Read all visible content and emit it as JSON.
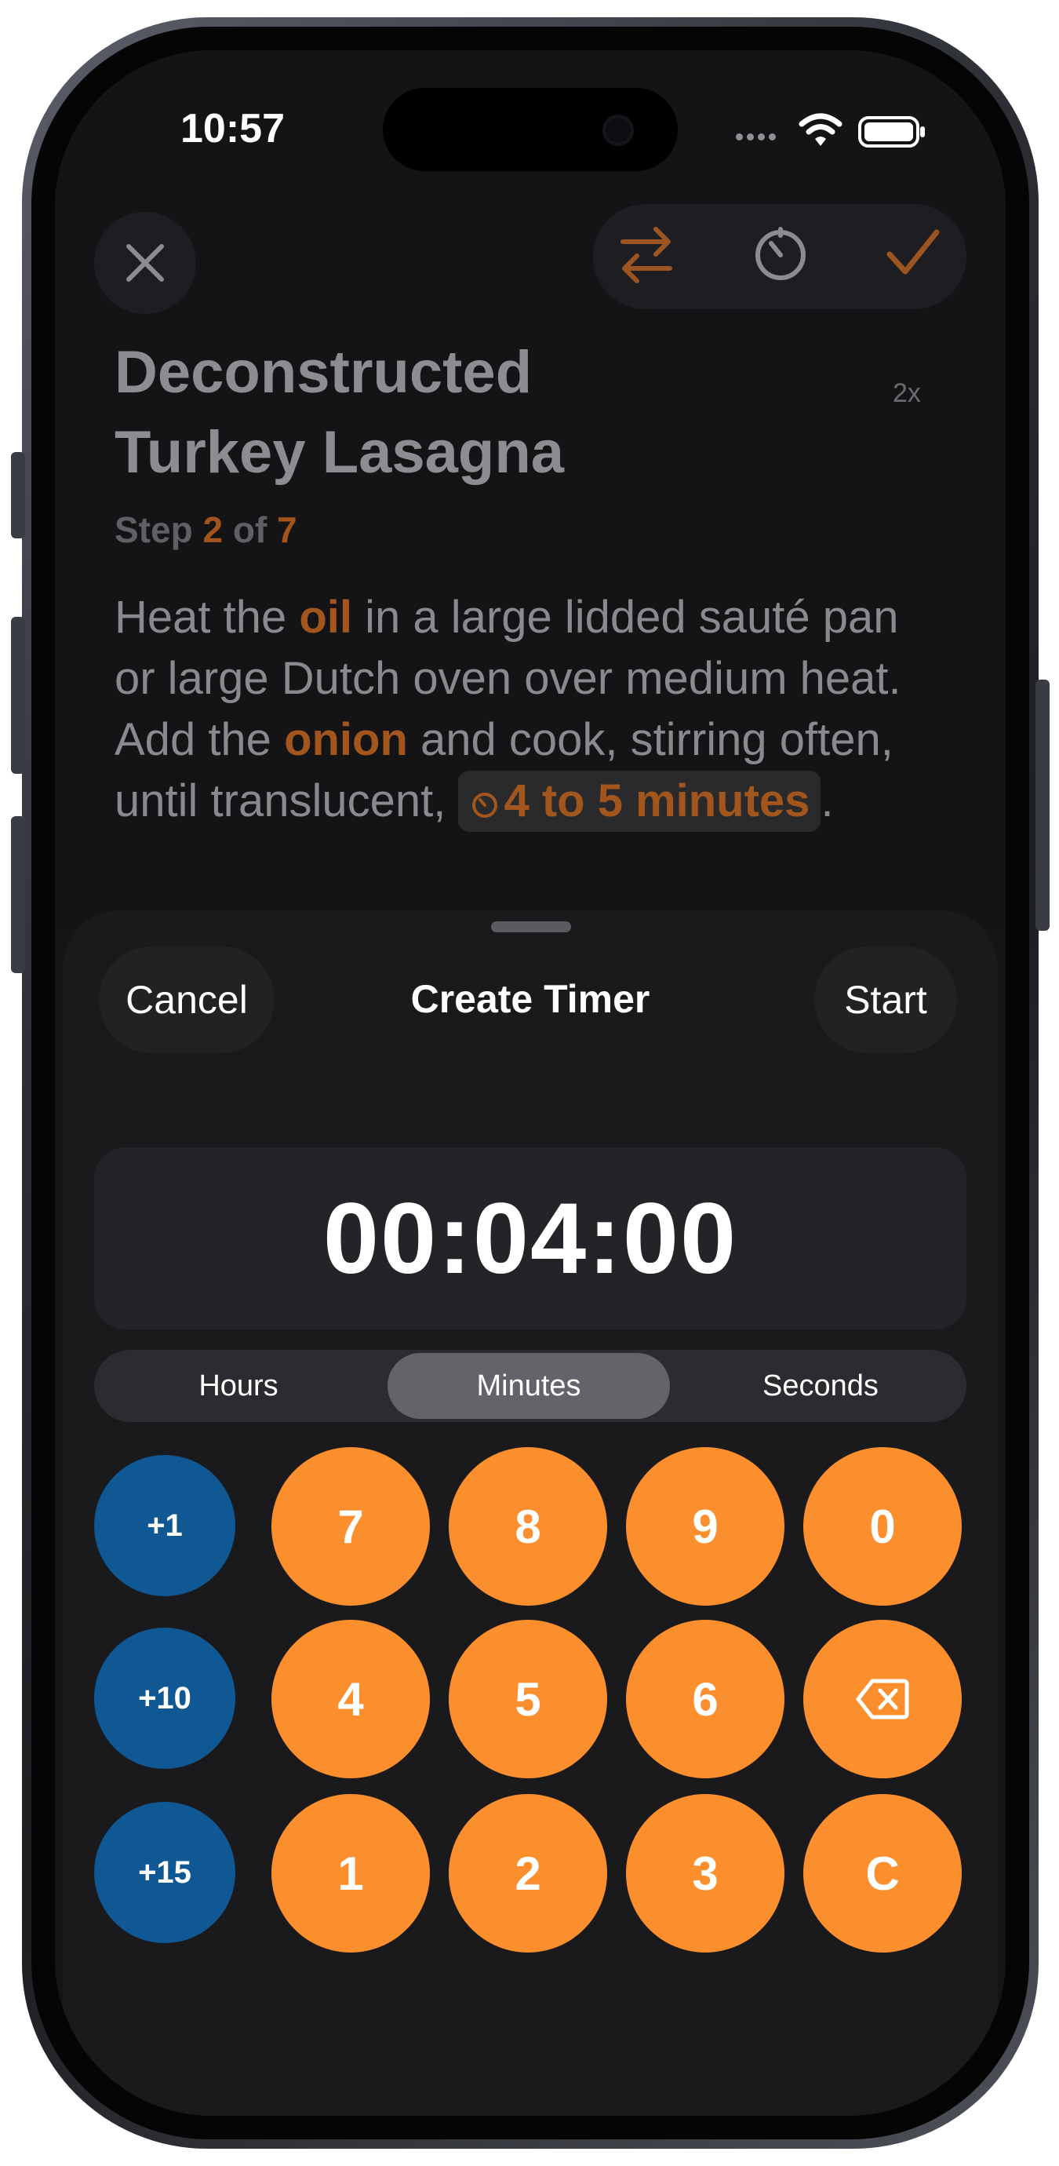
{
  "status_bar": {
    "time": "10:57"
  },
  "recipe": {
    "title_line1": "Deconstructed",
    "title_line2": "Turkey Lasagna",
    "multiplier": "2x",
    "step": {
      "prefix": "Step",
      "current": "2",
      "of": "of",
      "total": "7"
    },
    "instructions": {
      "p1": "Heat the ",
      "ing1": "oil",
      "p2": " in a large lidded sauté pan or large Dutch oven over medium heat. Add the ",
      "ing2": "onion",
      "p3": " and cook, stirring often, until translucent, ",
      "timer": "4 to 5 minutes",
      "p4": "."
    }
  },
  "sheet": {
    "cancel_label": "Cancel",
    "title": "Create Timer",
    "start_label": "Start",
    "display": "00:04:00",
    "segments": [
      "Hours",
      "Minutes",
      "Seconds"
    ],
    "selected_segment": "Minutes",
    "add_keys": [
      "+1",
      "+10",
      "+15"
    ],
    "digit_rows": [
      [
        "7",
        "8",
        "9",
        "0"
      ],
      [
        "4",
        "5",
        "6",
        "backspace"
      ],
      [
        "1",
        "2",
        "3",
        "C"
      ]
    ]
  },
  "colors": {
    "accent_orange": "#fb8e2d",
    "add_blue": "#0f5894",
    "sheet_bg": "#1a1a1d"
  }
}
